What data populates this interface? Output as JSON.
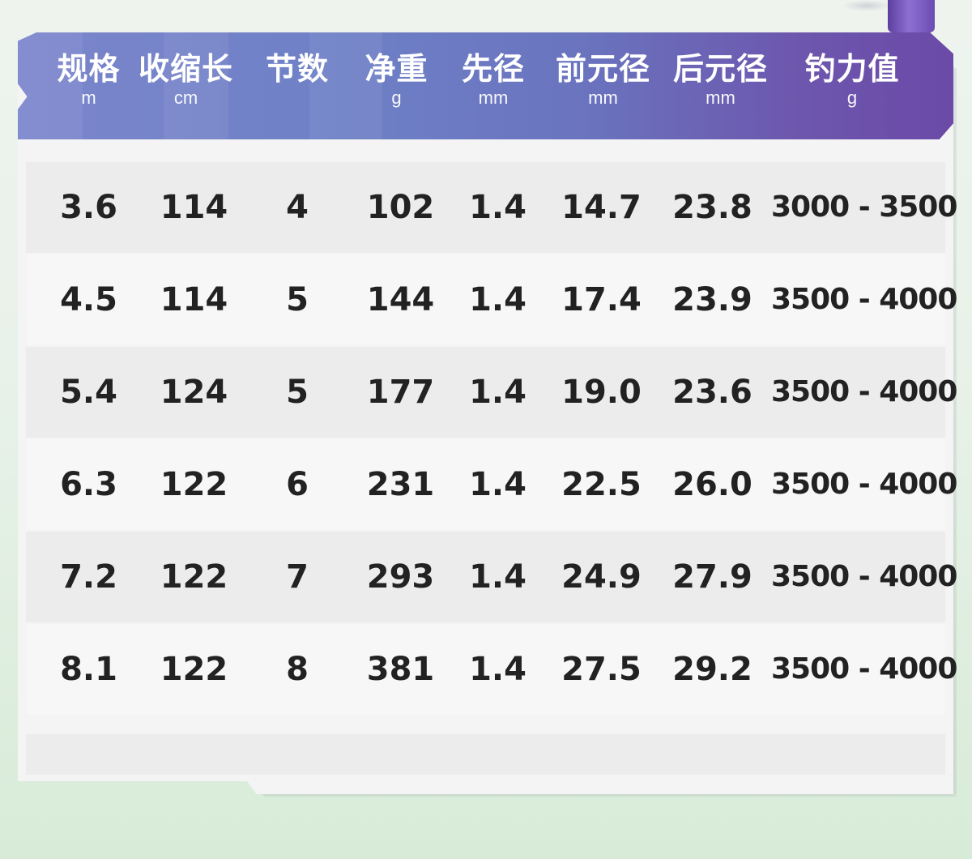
{
  "table": {
    "columns": [
      {
        "label": "规格",
        "unit": "m"
      },
      {
        "label": "收缩长",
        "unit": "cm"
      },
      {
        "label": "节数",
        "unit": ""
      },
      {
        "label": "净重",
        "unit": "g"
      },
      {
        "label": "先径",
        "unit": "mm"
      },
      {
        "label": "前元径",
        "unit": "mm"
      },
      {
        "label": "后元径",
        "unit": "mm"
      },
      {
        "label": "钓力值",
        "unit": "g"
      }
    ],
    "rows": [
      [
        "3.6",
        "114",
        "4",
        "102",
        "1.4",
        "14.7",
        "23.8",
        "3000 - 3500"
      ],
      [
        "4.5",
        "114",
        "5",
        "144",
        "1.4",
        "17.4",
        "23.9",
        "3500 - 4000"
      ],
      [
        "5.4",
        "124",
        "5",
        "177",
        "1.4",
        "19.0",
        "23.6",
        "3500 - 4000"
      ],
      [
        "6.3",
        "122",
        "6",
        "231",
        "1.4",
        "22.5",
        "26.0",
        "3500 - 4000"
      ],
      [
        "7.2",
        "122",
        "7",
        "293",
        "1.4",
        "24.9",
        "27.9",
        "3500 - 4000"
      ],
      [
        "8.1",
        "122",
        "8",
        "381",
        "1.4",
        "27.5",
        "29.2",
        "3500 - 4000"
      ]
    ]
  },
  "colors": {
    "header_start": "#7c86cc",
    "header_end": "#6b4aa8",
    "row_alt": "#ececed",
    "row_plain": "#f7f7f8",
    "text": "#222222"
  }
}
